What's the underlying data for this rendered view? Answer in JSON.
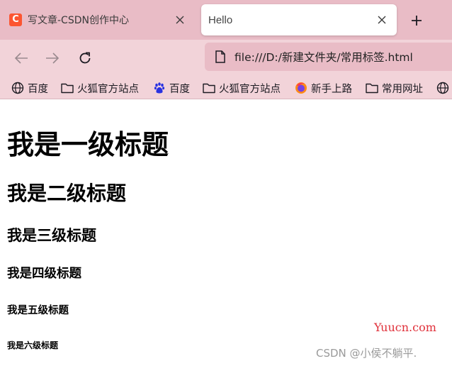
{
  "tabs": [
    {
      "title": "写文章-CSDN创作中心",
      "active": false,
      "favicon_letter": "C",
      "favicon_color": "#fc5531"
    },
    {
      "title": "Hello",
      "active": true
    }
  ],
  "address_bar": {
    "url": "file:///D:/新建文件夹/常用标签.html"
  },
  "bookmarks": [
    {
      "label": "百度",
      "icon": "globe-icon"
    },
    {
      "label": "火狐官方站点",
      "icon": "folder-icon"
    },
    {
      "label": "百度",
      "icon": "baidu-paw-icon"
    },
    {
      "label": "火狐官方站点",
      "icon": "folder-icon"
    },
    {
      "label": "新手上路",
      "icon": "firefox-icon"
    },
    {
      "label": "常用网址",
      "icon": "folder-icon"
    },
    {
      "label": "",
      "icon": "globe-icon"
    }
  ],
  "page": {
    "h1": "我是一级标题",
    "h2": "我是二级标题",
    "h3": "我是三级标题",
    "h4": "我是四级标题",
    "h5": "我是五级标题",
    "h6": "我是六级标题"
  },
  "watermarks": {
    "yuucn": "Yuucn.com",
    "csdn": "CSDN @小侯不躺平."
  },
  "colors": {
    "tabstrip": "#e9bcc6",
    "toolbar": "#f2d3d9",
    "csdn_orange": "#fc5531",
    "watermark_red": "#e0303a"
  }
}
